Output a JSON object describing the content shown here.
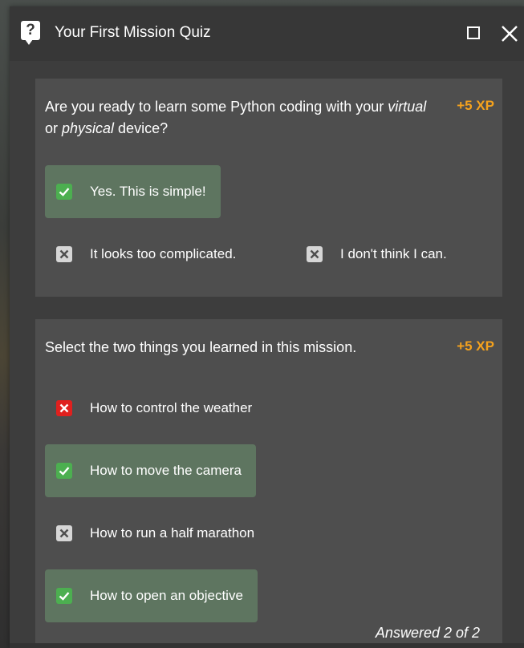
{
  "window": {
    "title": "Your First Mission Quiz",
    "icons": {
      "help": "help-icon",
      "maximize": "maximize-icon",
      "close": "close-icon"
    }
  },
  "colors": {
    "accent_xp": "#f5a21d",
    "correct": "#4caf50",
    "wrong": "#e0201e",
    "selected_bg": "#5e7560"
  },
  "questions": [
    {
      "text_part1": "Are you ready to learn some Python coding with your ",
      "text_virtual": "virtual",
      "text_or": " or ",
      "text_physical": "physical",
      "text_part2": " device?",
      "xp": "+5 XP",
      "options": [
        {
          "label": "Yes. This is simple!",
          "state": "correct",
          "selected": true
        },
        {
          "label": "It looks too complicated.",
          "state": "unselected",
          "selected": false
        },
        {
          "label": "I don't think I can.",
          "state": "unselected",
          "selected": false
        }
      ]
    },
    {
      "text": "Select the two things you learned in this mission.",
      "xp": "+5 XP",
      "options": [
        {
          "label": "How to control the weather",
          "state": "wrong",
          "selected": false
        },
        {
          "label": "How to move the camera",
          "state": "correct",
          "selected": true
        },
        {
          "label": "How to run a half marathon",
          "state": "unselected",
          "selected": false
        },
        {
          "label": "How to open an objective",
          "state": "correct",
          "selected": true
        }
      ]
    }
  ],
  "footer": {
    "answered": "Answered 2 of 2"
  }
}
